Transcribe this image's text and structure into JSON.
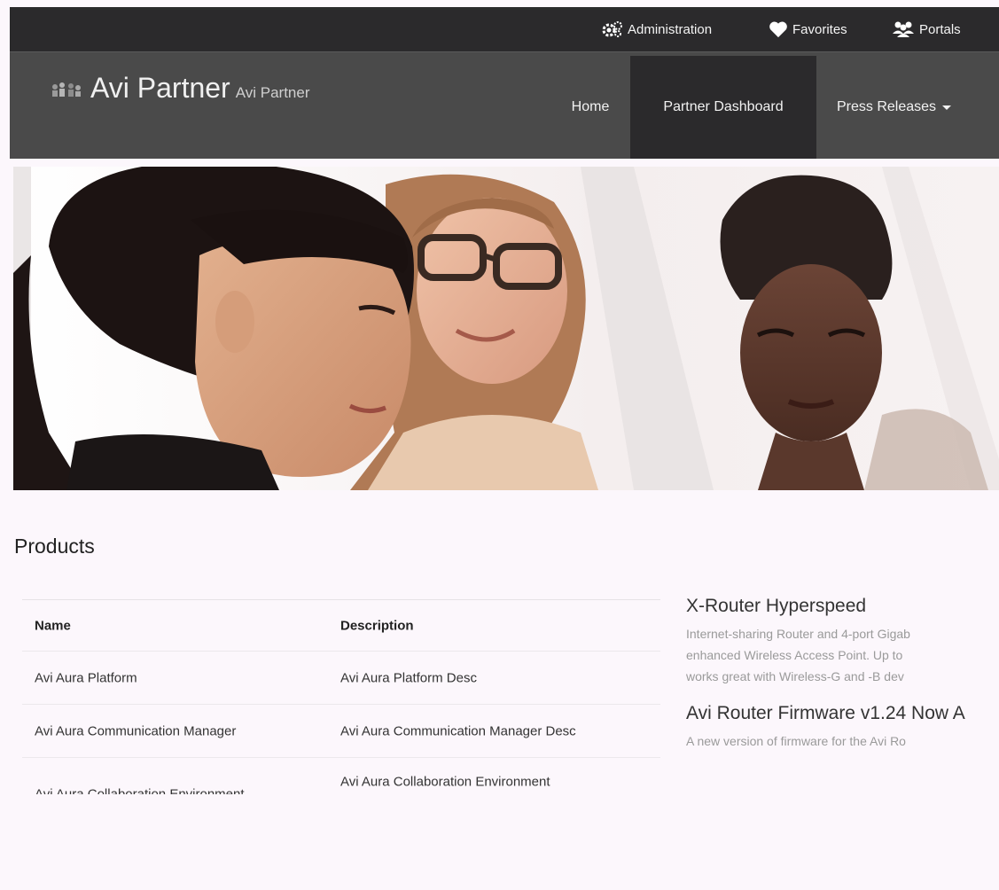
{
  "utility_bar": {
    "administration_label": "Administration",
    "favorites_label": "Favorites",
    "portals_label": "Portals"
  },
  "navbar": {
    "brand_title": "Avi Partner",
    "brand_subtitle": "Avi Partner",
    "items": [
      {
        "label": "Home"
      },
      {
        "label": "Partner Dashboard"
      },
      {
        "label": "Press Releases"
      }
    ]
  },
  "products": {
    "title": "Products",
    "columns": [
      "Name",
      "Description"
    ],
    "rows": [
      {
        "name": "Avi Aura Platform",
        "description": "Avi Aura Platform Desc"
      },
      {
        "name": "Avi Aura Communication Manager",
        "description": "Avi Aura Communication Manager Desc"
      },
      {
        "name": "Avi Aura Collaboration Environment",
        "description": "Avi Aura Collaboration Environment"
      }
    ]
  },
  "news": [
    {
      "title": "X-Router Hyperspeed",
      "lines": [
        "Internet-sharing Router and 4-port Gigab",
        "enhanced Wireless Access Point. Up to",
        "works great with Wireless-G and -B dev"
      ]
    },
    {
      "title": "Avi Router Firmware v1.24 Now A",
      "lines": [
        "A new version of firmware for the Avi Ro"
      ]
    }
  ],
  "colors": {
    "topbar": "#2b2a2c",
    "navbar": "#4a4a4a",
    "active_nav": "#2b2a2c",
    "page_background": "#fcf7fc"
  }
}
